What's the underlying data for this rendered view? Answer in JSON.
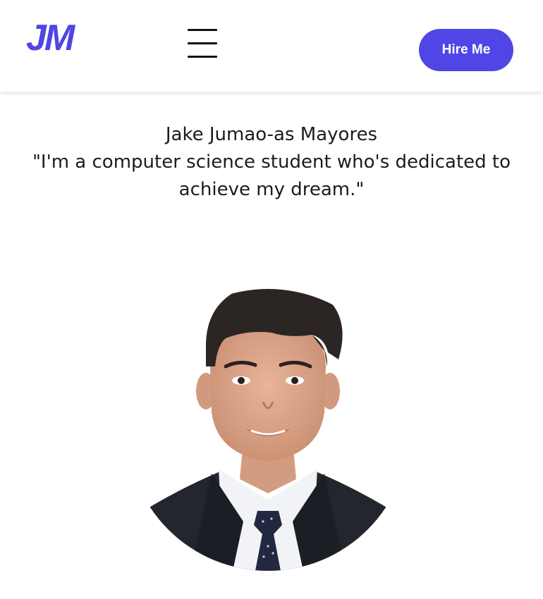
{
  "header": {
    "logo_text": "JM",
    "menu_icon": "hamburger-menu-icon",
    "hire_label": "Hire Me"
  },
  "hero": {
    "name": "Jake Jumao-as Mayores",
    "tagline": "\"I'm a computer science student who's dedicated to achieve my dream.\""
  },
  "colors": {
    "accent": "#4f46e5",
    "text": "#1c1c1c",
    "background": "#ffffff"
  }
}
